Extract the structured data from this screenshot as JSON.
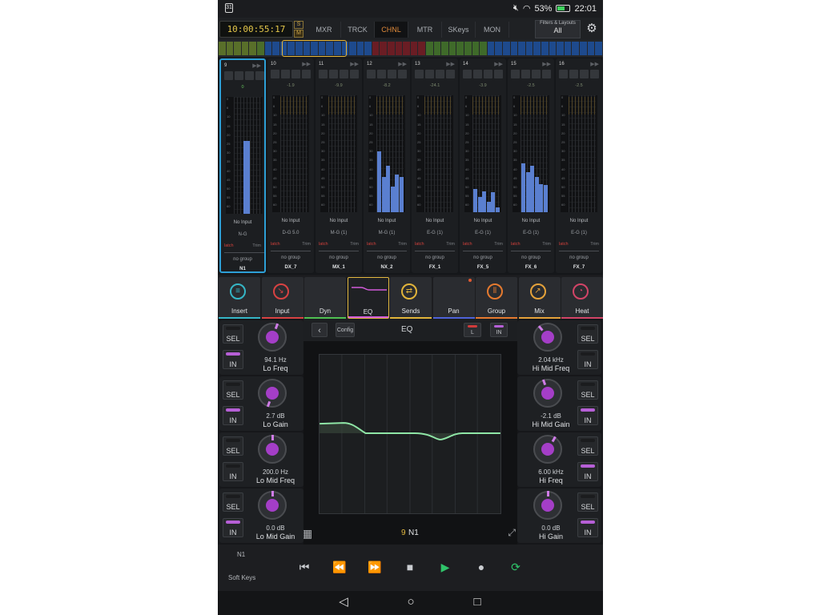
{
  "status": {
    "battery": "53%",
    "time": "22:01"
  },
  "topbar": {
    "timecode": "10:00:55:17",
    "s_label": "S",
    "m_label": "M",
    "tabs": [
      "MXR",
      "TRCK",
      "CHNL",
      "MTR",
      "SKeys",
      "MON"
    ],
    "active_tab": "CHNL",
    "filters_label": "Filters & Layouts",
    "filters_value": "All"
  },
  "channels": [
    {
      "num": "9",
      "db": "0",
      "input": "No Input",
      "route": "N-G",
      "latch": "latch",
      "trim": "Trim",
      "group": "no group",
      "name": "N1"
    },
    {
      "num": "10",
      "db": "-1.9",
      "input": "No Input",
      "route": "D-G 5.0",
      "latch": "latch",
      "trim": "Trim",
      "group": "no group",
      "name": "DX_7"
    },
    {
      "num": "11",
      "db": "-9.9",
      "input": "No Input",
      "route": "M-G (1)",
      "latch": "latch",
      "trim": "Trim",
      "group": "no group",
      "name": "MX_1"
    },
    {
      "num": "12",
      "db": "-8.2",
      "input": "No Input",
      "route": "M-G (1)",
      "latch": "latch",
      "trim": "Trim",
      "group": "no group",
      "name": "NX_2"
    },
    {
      "num": "13",
      "db": "-24.1",
      "input": "No Input",
      "route": "E-G (1)",
      "latch": "latch",
      "trim": "Trim",
      "group": "no group",
      "name": "FX_1"
    },
    {
      "num": "14",
      "db": "-3.9",
      "input": "No Input",
      "route": "E-G (1)",
      "latch": "latch",
      "trim": "Trim",
      "group": "no group",
      "name": "FX_5"
    },
    {
      "num": "15",
      "db": "-2.5",
      "input": "No Input",
      "route": "E-G (1)",
      "latch": "latch",
      "trim": "Trim",
      "group": "no group",
      "name": "FX_6"
    },
    {
      "num": "16",
      "db": "-2.5",
      "input": "No Input",
      "route": "E-G (1)",
      "latch": "latch",
      "trim": "Trim",
      "group": "no group",
      "name": "FX_7"
    }
  ],
  "meter_scale": [
    "0",
    "6",
    "10",
    "15",
    "20",
    "25",
    "30",
    "35",
    "40",
    "45",
    "50",
    "55",
    "60"
  ],
  "meter_levels": [
    [
      0.62
    ],
    [],
    [],
    [
      0.52,
      0.3,
      0.4,
      0.22,
      0.32,
      0.3
    ],
    [],
    [
      0.2,
      0.13,
      0.18,
      0.09,
      0.17,
      0.04
    ],
    [
      0.42,
      0.34,
      0.4,
      0.3,
      0.24,
      0.23
    ],
    []
  ],
  "sections": [
    {
      "label": "Insert",
      "color": "#35b6c6",
      "glyph": "≡"
    },
    {
      "label": "Input",
      "color": "#d84242",
      "glyph": "↘"
    },
    {
      "label": "Dyn",
      "color": "#4fbf52",
      "glyph": ""
    },
    {
      "label": "EQ",
      "color": "#d25bd9",
      "glyph": ""
    },
    {
      "label": "Sends",
      "color": "#e1b43a",
      "glyph": "⇄"
    },
    {
      "label": "Pan",
      "color": "#4e62d8",
      "glyph": ""
    },
    {
      "label": "Group",
      "color": "#e57a2f",
      "glyph": "⦀"
    },
    {
      "label": "Mix",
      "color": "#e5a23a",
      "glyph": "↗"
    },
    {
      "label": "Heat",
      "color": "#d24467",
      "glyph": "◔"
    }
  ],
  "eq": {
    "title": "EQ",
    "config": "Config",
    "l_label": "L",
    "in_label": "IN",
    "sel_label": "SEL",
    "channel_num": "9",
    "channel_name": "N1",
    "left_knobs": [
      {
        "value": "94.1 Hz",
        "name": "Lo Freq",
        "in_on": true
      },
      {
        "value": "2.7 dB",
        "name": "Lo Gain",
        "in_on": true
      },
      {
        "value": "200.0 Hz",
        "name": "Lo Mid Freq",
        "in_on": false
      },
      {
        "value": "0.0 dB",
        "name": "Lo Mid Gain",
        "in_on": true
      }
    ],
    "right_knobs": [
      {
        "value": "2.04 kHz",
        "name": "Hi Mid Freq",
        "in_on": false
      },
      {
        "value": "-2.1 dB",
        "name": "Hi Mid Gain",
        "in_on": true
      },
      {
        "value": "6.00 kHz",
        "name": "Hi Freq",
        "in_on": true
      },
      {
        "value": "0.0 dB",
        "name": "Hi Gain",
        "in_on": true
      }
    ]
  },
  "transport": {
    "track_name": "N1",
    "soft_keys": "Soft Keys"
  },
  "colors": {
    "accent": "#e3b940",
    "selected_strip": "#2d9fd6",
    "meter": "#5a7fd0",
    "eq_curve": "#8fe6a6",
    "knob": "#a43ec7"
  }
}
